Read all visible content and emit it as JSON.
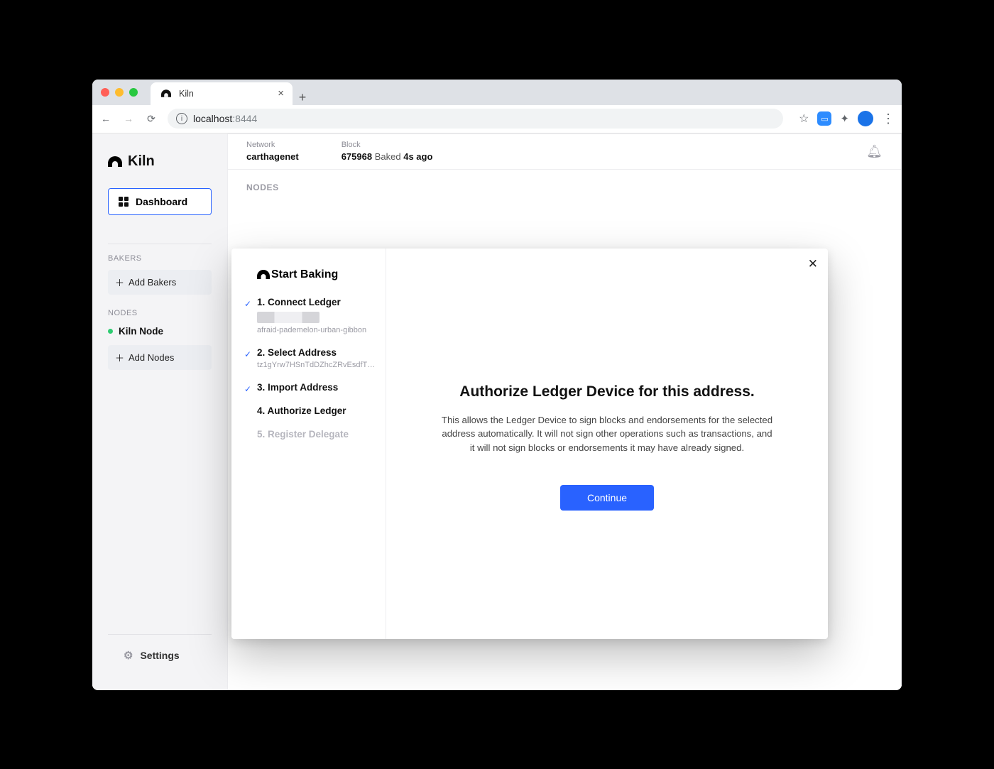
{
  "browser": {
    "tab_title": "Kiln",
    "url_host": "localhost",
    "url_port": ":8444"
  },
  "sidebar": {
    "app_name": "Kiln",
    "dashboard_label": "Dashboard",
    "bakers_label": "BAKERS",
    "add_bakers_label": "Add Bakers",
    "nodes_label": "NODES",
    "node_name": "Kiln Node",
    "add_nodes_label": "Add Nodes",
    "settings_label": "Settings"
  },
  "topbar": {
    "network_label": "Network",
    "network_value": "carthagenet",
    "block_label": "Block",
    "block_height": "675968",
    "block_baked_word": "Baked",
    "block_age": "4s ago"
  },
  "page": {
    "nodes_heading": "NODES"
  },
  "modal": {
    "title": "Start Baking",
    "steps": {
      "s1": {
        "title": "1. Connect Ledger",
        "sub": "afraid-pademelon-urban-gibbon"
      },
      "s2": {
        "title": "2. Select Address",
        "sub": "tz1gYrw7HSnTdDZhcZRvEsdfTgS..."
      },
      "s3": {
        "title": "3. Import Address"
      },
      "s4": {
        "title": "4. Authorize Ledger"
      },
      "s5": {
        "title": "5. Register Delegate"
      }
    },
    "right": {
      "heading": "Authorize Ledger Device for this address.",
      "body": "This allows the Ledger Device to sign blocks and endorsements for the selected address automatically. It will not sign other operations such as transactions, and it will not sign blocks or endorsements it may have already signed.",
      "continue_label": "Continue"
    }
  }
}
